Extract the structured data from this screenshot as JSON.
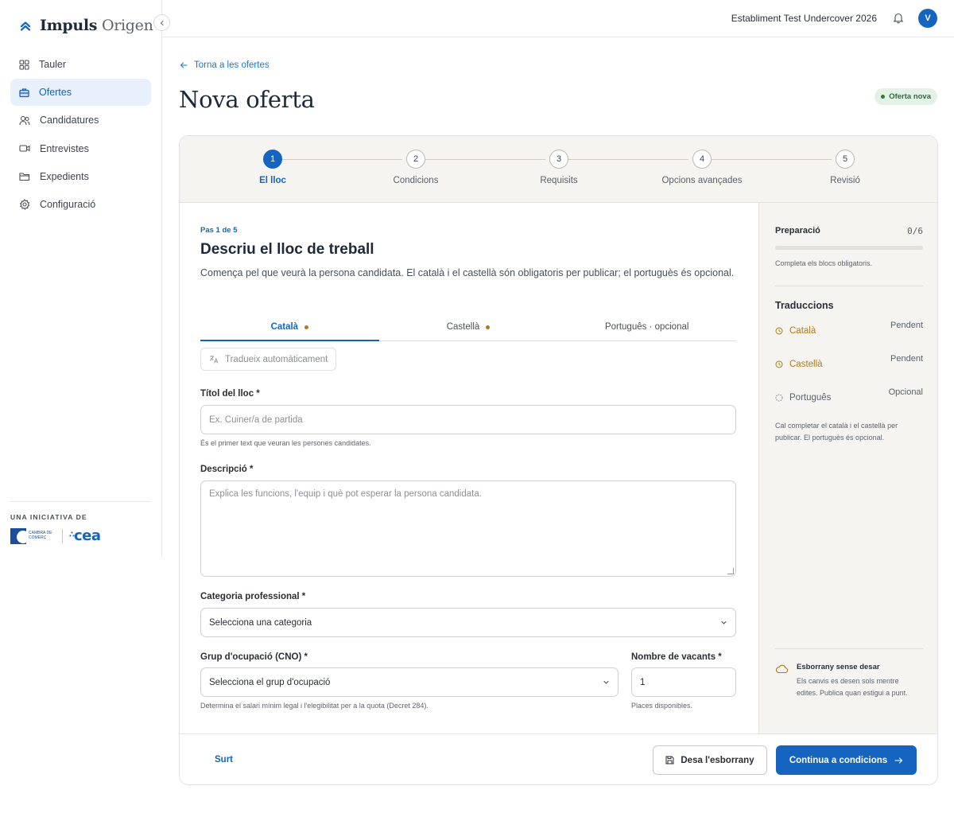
{
  "brand": {
    "name_bold": "Impuls",
    "name_light": "Origen"
  },
  "sidebar": {
    "items": [
      {
        "label": "Tauler",
        "icon": "grid-icon",
        "active": false
      },
      {
        "label": "Ofertes",
        "icon": "briefcase-icon",
        "active": true
      },
      {
        "label": "Candidatures",
        "icon": "users-icon",
        "active": false
      },
      {
        "label": "Entrevistes",
        "icon": "video-icon",
        "active": false
      },
      {
        "label": "Expedients",
        "icon": "folder-icon",
        "active": false
      },
      {
        "label": "Configuració",
        "icon": "gear-icon",
        "active": false
      }
    ],
    "initiative_label": "UNA INICIATIVA DE",
    "logo_cambra_text": "CAMBRA DE COMERÇ",
    "logo_cea_text": "cea"
  },
  "topbar": {
    "establishment": "Establiment Test Undercover 2026",
    "avatar_initial": "V"
  },
  "header": {
    "back_label": "Torna a les ofertes",
    "title": "Nova oferta",
    "badge": "Oferta nova"
  },
  "stepper": {
    "steps": [
      {
        "number": "1",
        "label": "El lloc",
        "active": true
      },
      {
        "number": "2",
        "label": "Condicions",
        "active": false
      },
      {
        "number": "3",
        "label": "Requisits",
        "active": false
      },
      {
        "number": "4",
        "label": "Opcions avançades",
        "active": false
      },
      {
        "number": "5",
        "label": "Revisió",
        "active": false
      }
    ]
  },
  "form": {
    "step_count": "Pas 1 de 5",
    "title": "Descriu el lloc de treball",
    "description": "Comença pel que veurà la persona candidata. El català i el castellà són obligatoris per publicar; el portuguès és opcional.",
    "tabs": [
      {
        "label": "Català",
        "pending": true,
        "active": true
      },
      {
        "label": "Castellà",
        "pending": true,
        "active": false
      },
      {
        "label": "Português · opcional",
        "pending": false,
        "active": false
      }
    ],
    "translate_button": "Tradueix automàticament",
    "job_title": {
      "label": "Títol del lloc *",
      "placeholder": "Ex. Cuiner/a de partida",
      "hint": "És el primer text que veuran les persones candidates."
    },
    "description_field": {
      "label": "Descripció *",
      "placeholder": "Explica les funcions, l'equip i què pot esperar la persona candidata."
    },
    "category": {
      "label": "Categoria professional *",
      "value": "Selecciona una categoria"
    },
    "occupation_group": {
      "label": "Grup d'ocupació (CNO) *",
      "value": "Selecciona el grup d'ocupació",
      "hint": "Determina el salari mínim legal i l'elegibilitat per a la quota (Decret 284)."
    },
    "vacancies": {
      "label": "Nombre de vacants *",
      "value": "1",
      "hint": "Places disponibles."
    }
  },
  "side": {
    "prep_title": "Preparació",
    "prep_count": "0/6",
    "prep_progress": 0,
    "prep_hint": "Completa els blocs obligatoris.",
    "translations_title": "Traduccions",
    "translations": [
      {
        "lang": "Català",
        "status": "Pendent",
        "state": "pending"
      },
      {
        "lang": "Castellà",
        "status": "Pendent",
        "state": "pending"
      },
      {
        "lang": "Português",
        "status": "Opcional",
        "state": "optional"
      }
    ],
    "translations_note": "Cal completar el català i el castellà per publicar. El portuguès és opcional.",
    "draft_title": "Esborrany sense desar",
    "draft_text": "Els canvis es desen sols mentre edites. Publica quan estigui a punt."
  },
  "footer": {
    "exit_label": "Surt",
    "save_draft_label": "Desa l'esborrany",
    "continue_label": "Continua a condicions"
  },
  "colors": {
    "accent": "#1565c0",
    "pending": "#b07a1c",
    "badge_bg": "#e4f1e6",
    "panel_bg": "#f5f4f0"
  }
}
